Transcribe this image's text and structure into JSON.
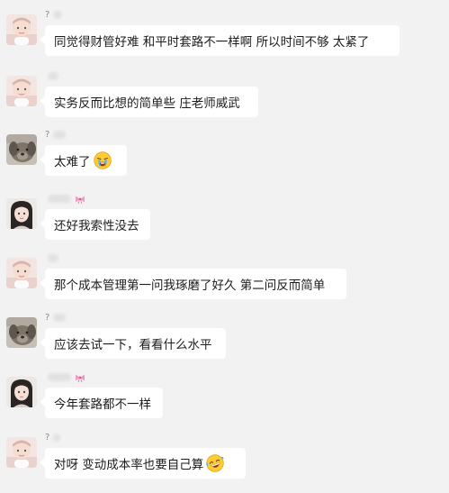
{
  "chat": {
    "messages": [
      {
        "sender": "?",
        "text": "同觉得财管好难  和平时套路不一样啊  所以时间不够  太紧了",
        "avatar": "avatar-baby",
        "name_icon": "",
        "emoji": ""
      },
      {
        "sender": "",
        "text": "实务反而比想的简单些  庄老师威武",
        "avatar": "avatar-baby",
        "name_icon": "",
        "emoji": ""
      },
      {
        "sender": "?",
        "text": "太难了",
        "avatar": "avatar-dog",
        "name_icon": "",
        "emoji": "crying-face-icon"
      },
      {
        "sender": "",
        "text": "还好我索性没去",
        "avatar": "avatar-girl",
        "name_icon": "pink-bow-icon",
        "emoji": ""
      },
      {
        "sender": "",
        "text": "那个成本管理第一问我琢磨了好久  第二问反而简单",
        "avatar": "avatar-baby",
        "name_icon": "",
        "emoji": ""
      },
      {
        "sender": "?",
        "text": "应该去试一下，看看什么水平",
        "avatar": "avatar-dog",
        "name_icon": "",
        "emoji": ""
      },
      {
        "sender": "",
        "text": "今年套路都不一样",
        "avatar": "avatar-girl",
        "name_icon": "pink-bow-icon",
        "emoji": ""
      },
      {
        "sender": "?",
        "text": "对呀  变动成本率也要自己算",
        "avatar": "avatar-baby",
        "name_icon": "",
        "emoji": "laughing-tears-icon"
      }
    ]
  },
  "colors": {
    "background": "#f2f2f2",
    "bubble": "#ffffff",
    "text": "#1c1c1c",
    "sender_name": "#8c8c8c"
  }
}
